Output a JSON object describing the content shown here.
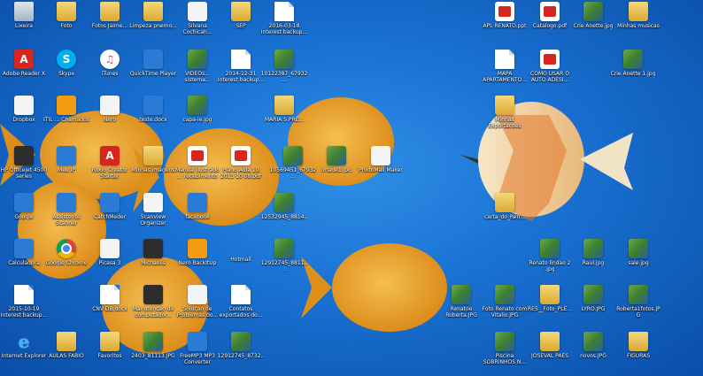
{
  "wallpaper": {
    "color": "#1a73d4",
    "description_color_fish": "#f5a623"
  },
  "icons": [
    {
      "id": "lixeira",
      "label": "Lixeira",
      "type": "recycle",
      "icon": "recycle-bin-icon"
    },
    {
      "id": "foto",
      "label": "Foto",
      "type": "folder",
      "icon": "folder-icon"
    },
    {
      "id": "fotos-jaime",
      "label": "Fotos Jaime...",
      "type": "folder",
      "icon": "folder-icon"
    },
    {
      "id": "limpeza",
      "label": "Limpeza pnemo...",
      "type": "folder",
      "icon": "folder-icon"
    },
    {
      "id": "silvana",
      "label": "Silvana Cochicah... Espaco Viagens...",
      "type": "app-white",
      "icon": "document-icon"
    },
    {
      "id": "sep",
      "label": "SEP",
      "type": "folder",
      "icon": "folder-icon"
    },
    {
      "id": "doc-2016",
      "label": "2016-03-18 Interest backup...",
      "type": "doc",
      "icon": "document-icon"
    },
    {
      "id": "adobe",
      "label": "Adobe Reader X",
      "type": "app-red",
      "icon": "adobe-reader-icon"
    },
    {
      "id": "skype",
      "label": "Skype",
      "type": "skype",
      "icon": "skype-icon"
    },
    {
      "id": "itunes",
      "label": "iTunes",
      "type": "itunes",
      "icon": "itunes-icon"
    },
    {
      "id": "quicktime",
      "label": "QuickTime Player",
      "type": "app-blue",
      "icon": "quicktime-icon"
    },
    {
      "id": "zap",
      "label": "VIDEOs... sistema...",
      "type": "photo",
      "icon": "image-icon"
    },
    {
      "id": "doc-2014",
      "label": "2014-12-31 Interest backup...",
      "type": "doc",
      "icon": "document-icon"
    },
    {
      "id": "img-1022",
      "label": "10122387_67932...",
      "type": "photo",
      "icon": "image-icon"
    },
    {
      "id": "dropbox",
      "label": "Dropbox",
      "type": "app-white",
      "icon": "dropbox-icon"
    },
    {
      "id": "chamados",
      "label": "ITIL ... Chamados",
      "type": "app-orange",
      "icon": "app-icon"
    },
    {
      "id": "nero",
      "label": "Nero",
      "type": "app-white",
      "icon": "nero-icon"
    },
    {
      "id": "word",
      "label": "teste.docx",
      "type": "app-blue",
      "icon": "word-icon"
    },
    {
      "id": "capa",
      "label": "capa-ie.jpg",
      "type": "photo",
      "icon": "image-icon"
    },
    {
      "id": "maria-pr",
      "label": "MARIA S PRE...",
      "type": "folder",
      "icon": "folder-icon"
    },
    {
      "id": "hp",
      "label": "HP Officejet 4500 series",
      "type": "app-dark",
      "icon": "printer-icon"
    },
    {
      "id": "meuip",
      "label": "Meu IP",
      "type": "app-blue",
      "icon": "network-icon"
    },
    {
      "id": "roxio",
      "label": "Roxio Creator Starter",
      "type": "app-red",
      "icon": "roxio-icon"
    },
    {
      "id": "minhas-imagens",
      "label": "Minhas imagens",
      "type": "folder",
      "icon": "folder-icon"
    },
    {
      "id": "manual",
      "label": "Manual ilustrado ... recebimento",
      "type": "pdf",
      "icon": "pdf-icon"
    },
    {
      "id": "plano",
      "label": "Plano Aula 10 2013 10 08.pdf",
      "type": "pdf",
      "icon": "pdf-icon"
    },
    {
      "id": "img-10569",
      "label": "10569451_67932...",
      "type": "photo",
      "icon": "image-icon"
    },
    {
      "id": "image1",
      "label": "image1.jpg",
      "type": "photo",
      "icon": "image-icon"
    },
    {
      "id": "photomail",
      "label": "PhotoMail Maker",
      "type": "app-white",
      "icon": "photomail-icon"
    },
    {
      "id": "google",
      "label": "Google",
      "type": "app-blue",
      "icon": "globe-icon"
    },
    {
      "id": "scanner",
      "label": "Assistente Scanner",
      "type": "app-blue",
      "icon": "scanner-icon"
    },
    {
      "id": "catchmeder",
      "label": "CatchMeder",
      "type": "app-blue",
      "icon": "app-icon"
    },
    {
      "id": "scanview",
      "label": "Scanview Organizer",
      "type": "app-white",
      "icon": "app-icon"
    },
    {
      "id": "facebook",
      "label": "facebook",
      "type": "app-blue",
      "icon": "facebook-icon"
    },
    {
      "id": "img-1253",
      "label": "12532945_8814...",
      "type": "photo",
      "icon": "image-icon"
    },
    {
      "id": "calculadora",
      "label": "Calculadora",
      "type": "app-blue",
      "icon": "calculator-icon"
    },
    {
      "id": "chrome",
      "label": "Google Chrome",
      "type": "chrome",
      "icon": "chrome-icon"
    },
    {
      "id": "picasa",
      "label": "Picasa 3",
      "type": "app-white",
      "icon": "picasa-icon"
    },
    {
      "id": "michaelis",
      "label": "Michaelis",
      "type": "app-dark",
      "icon": "pic-icon"
    },
    {
      "id": "nerobackitup",
      "label": "Nero BackItUp",
      "type": "app-orange",
      "icon": "nero-backup-icon"
    },
    {
      "id": "hotmail",
      "label": "Hotmail",
      "type": "windows",
      "icon": "windows-logo-icon"
    },
    {
      "id": "img-1291",
      "label": "12912745_8811...",
      "type": "photo",
      "icon": "image-icon"
    },
    {
      "id": "doc-2015",
      "label": "2015-10-19 Interest backup...",
      "type": "doc",
      "icon": "document-icon"
    },
    {
      "id": "cnvdb",
      "label": "CNV-DB.docx",
      "type": "doc",
      "icon": "document-icon"
    },
    {
      "id": "manut",
      "label": "Manutencao de computador...",
      "type": "app-dark",
      "icon": "app-icon"
    },
    {
      "id": "solucao",
      "label": "Solucao de Problemas do...",
      "type": "app-white",
      "icon": "app-icon"
    },
    {
      "id": "contatos",
      "label": "Contatos exportados do...",
      "type": "doc",
      "icon": "document-icon"
    },
    {
      "id": "ie",
      "label": "Internet Explorer",
      "type": "ie",
      "icon": "internet-explorer-icon"
    },
    {
      "id": "aulas-fabio",
      "label": "AULAS FABIO",
      "type": "folder",
      "icon": "folder-icon"
    },
    {
      "id": "favoritos",
      "label": "Favoritos",
      "type": "folder",
      "icon": "folder-icon"
    },
    {
      "id": "img-2403",
      "label": "2403_81113.JPG",
      "type": "photo",
      "icon": "image-icon"
    },
    {
      "id": "freemp3",
      "label": "FreeMP3 MP3 Converter",
      "type": "app-blue",
      "icon": "app-icon"
    },
    {
      "id": "img-1291b",
      "label": "12912745_8732...",
      "type": "photo",
      "icon": "image-icon"
    },
    {
      "id": "apl-renato",
      "label": "APL RENATO.ppt",
      "type": "pdf",
      "icon": "presentation-icon"
    },
    {
      "id": "catalogo",
      "label": "Catalogo.pdf",
      "type": "pdf",
      "icon": "pdf-icon"
    },
    {
      "id": "crie-anette",
      "label": "Crie Anette.jpg",
      "type": "photo",
      "icon": "image-icon"
    },
    {
      "id": "minhas-musicas",
      "label": "Minhas musicas",
      "type": "folder",
      "icon": "folder-icon"
    },
    {
      "id": "mapa",
      "label": "MAPA APARTAMENTO...",
      "type": "doc",
      "icon": "document-icon"
    },
    {
      "id": "como-usar",
      "label": "COMO USAR O AUTO ADESI...",
      "type": "pdf",
      "icon": "pdf-icon"
    },
    {
      "id": "crie-anette2",
      "label": "Crie Anette 1.jpg",
      "type": "photo",
      "icon": "image-icon"
    },
    {
      "id": "minhas-exporta",
      "label": "Minhas Exportacoes",
      "type": "folder",
      "icon": "folder-icon"
    },
    {
      "id": "carta",
      "label": "carta_do_Ren...",
      "type": "folder",
      "icon": "folder-icon"
    },
    {
      "id": "renato-2",
      "label": "Renato lindao 2 .jpg",
      "type": "photo",
      "icon": "image-icon"
    },
    {
      "id": "raul",
      "label": "Raul.jpg",
      "type": "photo",
      "icon": "image-icon"
    },
    {
      "id": "sale",
      "label": "sale.jpg",
      "type": "photo",
      "icon": "image-icon"
    },
    {
      "id": "renato-rob",
      "label": "Renatoe Roberta.JPG",
      "type": "photo",
      "icon": "image-icon"
    },
    {
      "id": "foto-renato",
      "label": "Foto Renato com Vitalio.JPG",
      "type": "photo",
      "icon": "image-icon"
    },
    {
      "id": "res-foto",
      "label": "RES__Foto_PLE...",
      "type": "folder",
      "icon": "folder-icon"
    },
    {
      "id": "lyro",
      "label": "LYRO.JPG",
      "type": "photo",
      "icon": "image-icon"
    },
    {
      "id": "roberta",
      "label": "Roberta1fotos.JPG",
      "type": "photo",
      "icon": "image-icon"
    },
    {
      "id": "piscina",
      "label": "Piscina SOBRINHOS N...",
      "type": "photo",
      "icon": "image-icon"
    },
    {
      "id": "josival",
      "label": "JOSEVAL PAES",
      "type": "folder",
      "icon": "folder-icon"
    },
    {
      "id": "novos",
      "label": "novos.JPG",
      "type": "photo",
      "icon": "image-icon"
    },
    {
      "id": "figuras",
      "label": "FIGURAS",
      "type": "folder",
      "icon": "folder-icon"
    }
  ]
}
